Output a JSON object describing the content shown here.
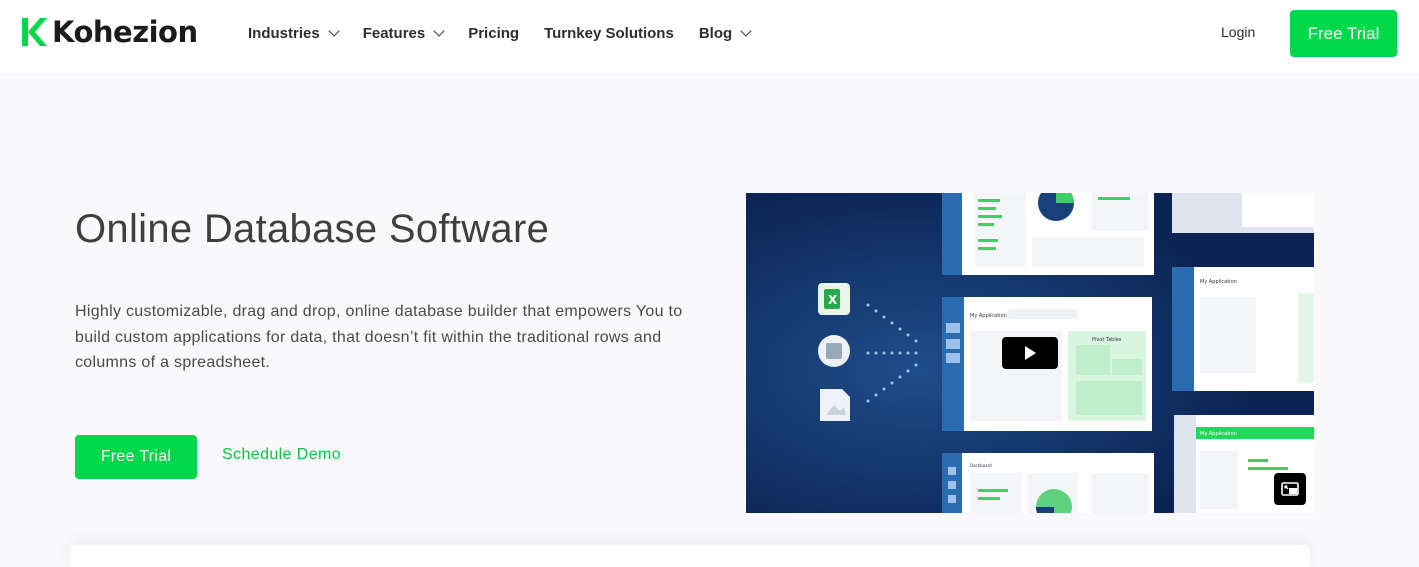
{
  "brand": {
    "name": "Kohezion",
    "accent": "#00d84a",
    "link_color": "#00c843",
    "video_bg": "#0d2a5c"
  },
  "nav": {
    "items": [
      {
        "label": "Industries",
        "has_dropdown": true
      },
      {
        "label": "Features",
        "has_dropdown": true
      },
      {
        "label": "Pricing",
        "has_dropdown": false
      },
      {
        "label": "Turnkey Solutions",
        "has_dropdown": false
      },
      {
        "label": "Blog",
        "has_dropdown": true
      }
    ],
    "login_label": "Login",
    "trial_label": "Free Trial"
  },
  "hero": {
    "title": "Online Database Software",
    "description": "Highly customizable, drag and drop, online database builder that empowers You to build custom applications for data, that doesn’t fit within the traditional rows and columns of a spreadsheet.",
    "primary_cta": "Free Trial",
    "secondary_cta": "Schedule Demo"
  },
  "video": {
    "play_icon": "play-icon",
    "pip_icon": "picture-in-picture-icon",
    "screens": {
      "my_application": "My Application",
      "pivot_tables": "Pivot Tables",
      "dashboard": "Dashboard",
      "excel_badge": "X"
    }
  }
}
